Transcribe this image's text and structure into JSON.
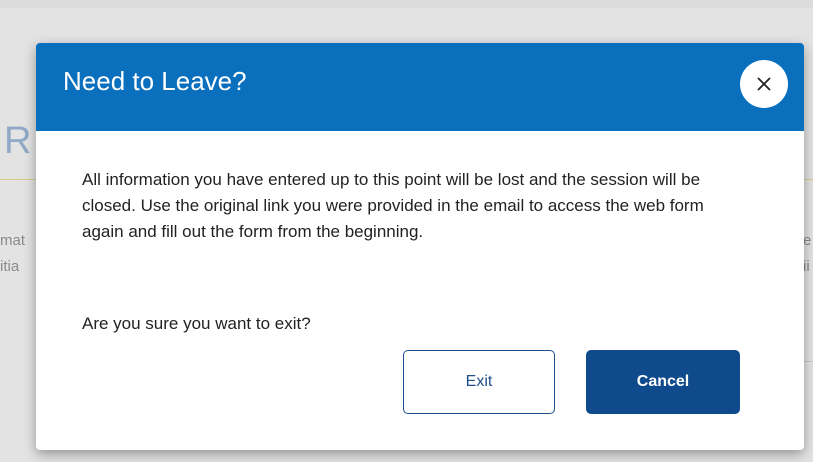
{
  "background": {
    "heading": "R",
    "text_left_1": "mat",
    "text_left_2": "itia",
    "text_right_1": "e",
    "text_right_2": "ii"
  },
  "dialog": {
    "title": "Need to Leave?",
    "close_label": "×",
    "message": "All information you have entered up to this point will be lost and the session will be closed. Use the original link you were provided in the email to access the web form again and fill out the form from the beginning.",
    "question": "Are you sure you want to exit?",
    "exit_label": "Exit",
    "cancel_label": "Cancel"
  },
  "colors": {
    "header_bg": "#0a6fbd",
    "primary_button": "#0f4a8c",
    "secondary_button_border": "#1f4f8a"
  },
  "icons": {
    "close": "close-icon"
  }
}
